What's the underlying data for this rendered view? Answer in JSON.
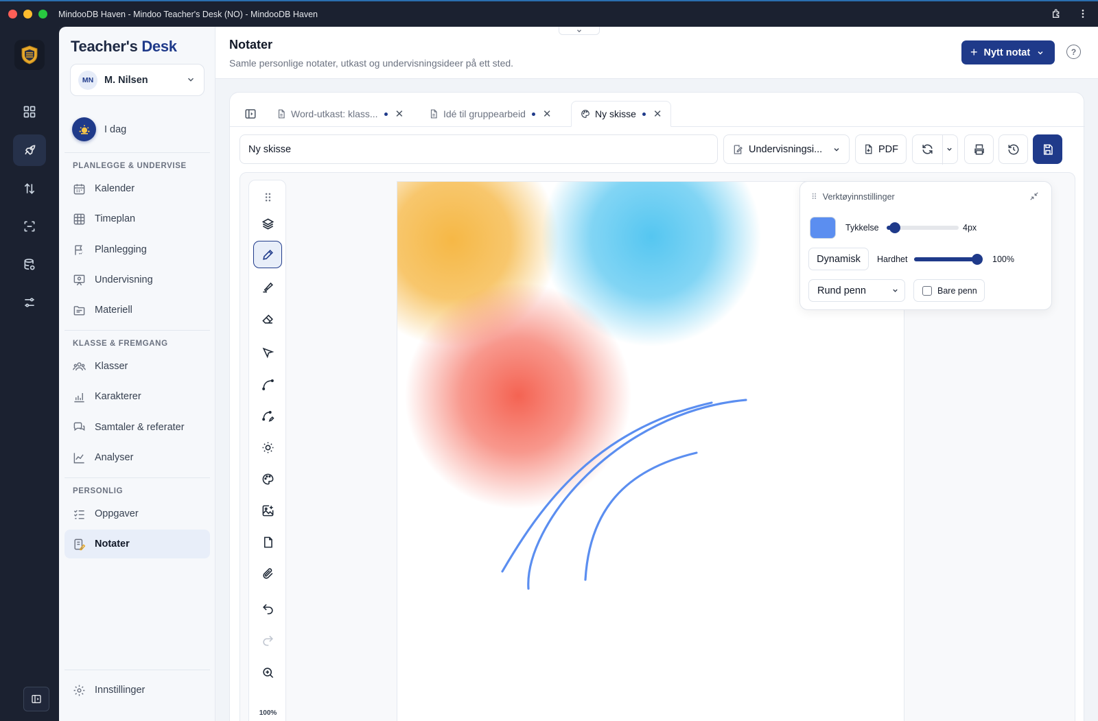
{
  "window": {
    "title": "MindooDB Haven - Mindoo Teacher's Desk (NO) - MindooDB Haven"
  },
  "brand": {
    "part1": "Teacher's",
    "part2": "Desk"
  },
  "user": {
    "initials": "MN",
    "name": "M. Nilsen"
  },
  "today": {
    "label": "I dag"
  },
  "sidebar": {
    "sections": [
      {
        "title": "PLANLEGGE & UNDERVISE"
      },
      {
        "title": "KLASSE & FREMGANG"
      },
      {
        "title": "PERSONLIG"
      }
    ],
    "items": [
      {
        "label": "Kalender",
        "icon": "calendar-icon"
      },
      {
        "label": "Timeplan",
        "icon": "grid-icon"
      },
      {
        "label": "Planlegging",
        "icon": "flag-icon"
      },
      {
        "label": "Undervisning",
        "icon": "presentation-icon"
      },
      {
        "label": "Materiell",
        "icon": "folder-icon"
      },
      {
        "label": "Klasser",
        "icon": "users-icon"
      },
      {
        "label": "Karakterer",
        "icon": "bar-chart-icon"
      },
      {
        "label": "Samtaler & referater",
        "icon": "chat-icon"
      },
      {
        "label": "Analyser",
        "icon": "line-chart-icon"
      },
      {
        "label": "Oppgaver",
        "icon": "checklist-icon"
      },
      {
        "label": "Notater",
        "icon": "notes-icon",
        "active": true
      }
    ],
    "settings_label": "Innstillinger"
  },
  "header": {
    "title": "Notater",
    "subtitle": "Samle personlige notater, utkast og undervisningsideer på ett sted.",
    "new_button": "Nytt notat"
  },
  "tabs": [
    {
      "label": "Word-utkast: klass...",
      "unsaved": true
    },
    {
      "label": "Idé til gruppearbeid",
      "unsaved": true
    },
    {
      "label": "Ny skisse",
      "unsaved": true,
      "active": true
    }
  ],
  "editor": {
    "title_value": "Ny skisse",
    "category": "Undervisningsi...",
    "pdf_label": "PDF",
    "zoom": "100%"
  },
  "tool_settings": {
    "title": "Verktøyinnstillinger",
    "pen_color": "#5b8ef0",
    "thickness_label": "Tykkelse",
    "thickness_value": "4px",
    "thickness_fraction": 0.05,
    "dynamic_label": "Dynamisk",
    "hardness_label": "Hardhet",
    "hardness_value": "100%",
    "hardness_fraction": 1.0,
    "pen_type": "Rund penn",
    "pen_only_label": "Bare penn",
    "pen_only_checked": false
  },
  "colors": {
    "accent": "#1f3a8a",
    "blob_orange": "#f5b43c",
    "blob_blue": "#4cc3f0",
    "blob_red": "#f4604f",
    "stroke": "#5b8ef0"
  }
}
